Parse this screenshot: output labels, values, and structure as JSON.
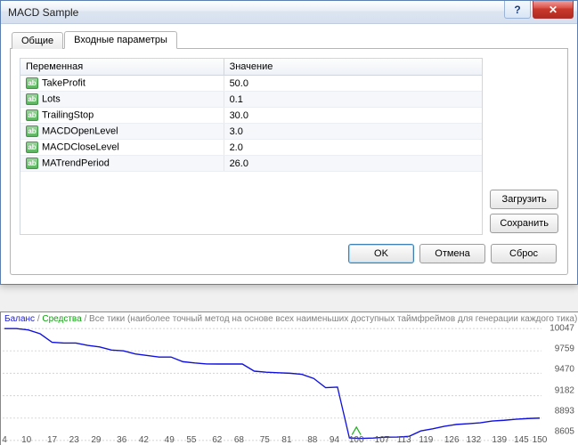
{
  "dialog": {
    "title": "MACD Sample"
  },
  "tabs": {
    "general": "Общие",
    "inputs": "Входные параметры"
  },
  "table": {
    "col_var": "Переменная",
    "col_val": "Значение",
    "rows": [
      {
        "name": "TakeProfit",
        "value": "50.0"
      },
      {
        "name": "Lots",
        "value": "0.1"
      },
      {
        "name": "TrailingStop",
        "value": "30.0"
      },
      {
        "name": "MACDOpenLevel",
        "value": "3.0"
      },
      {
        "name": "MACDCloseLevel",
        "value": "2.0"
      },
      {
        "name": "MATrendPeriod",
        "value": "26.0"
      }
    ]
  },
  "buttons": {
    "load": "Загрузить",
    "save": "Сохранить",
    "ok": "OK",
    "cancel": "Отмена",
    "reset": "Сброс",
    "help_glyph": "?",
    "close_glyph": "✕"
  },
  "chart_caption": {
    "balance": "Баланс",
    "equity": "Средства",
    "rest": "Все тики (наиболее точный метод на основе всех наименьших доступных таймфреймов для генерации каждого тика) / n/a",
    "sep": " / "
  },
  "chart_data": {
    "type": "line",
    "x": [
      4,
      10,
      17,
      23,
      29,
      36,
      42,
      49,
      55,
      62,
      68,
      75,
      81,
      88,
      94,
      100,
      107,
      113,
      119,
      126,
      132,
      139,
      145,
      150
    ],
    "series": [
      {
        "name": "Средства",
        "values": [
          10047,
          10047,
          10030,
          9980,
          9870,
          9860,
          9860,
          9830,
          9810,
          9770,
          9760,
          9720,
          9700,
          9680,
          9680,
          9620,
          9603,
          9591,
          9590,
          9590,
          9590,
          9498,
          9485,
          9477,
          9471,
          9457,
          9404,
          9285,
          9292,
          8637,
          8631,
          8635,
          8647,
          8648,
          8656,
          8727,
          8755,
          8787,
          8811,
          8820,
          8832,
          8855,
          8864,
          8878,
          8887,
          8893
        ]
      }
    ],
    "ylim": [
      8605,
      10047
    ],
    "yticks": [
      10047,
      9759,
      9470,
      9182,
      8893,
      8605
    ],
    "xticks": [
      4,
      10,
      17,
      23,
      29,
      36,
      42,
      49,
      55,
      62,
      68,
      75,
      81,
      88,
      94,
      100,
      107,
      113,
      119,
      126,
      132,
      139,
      145,
      150
    ]
  }
}
